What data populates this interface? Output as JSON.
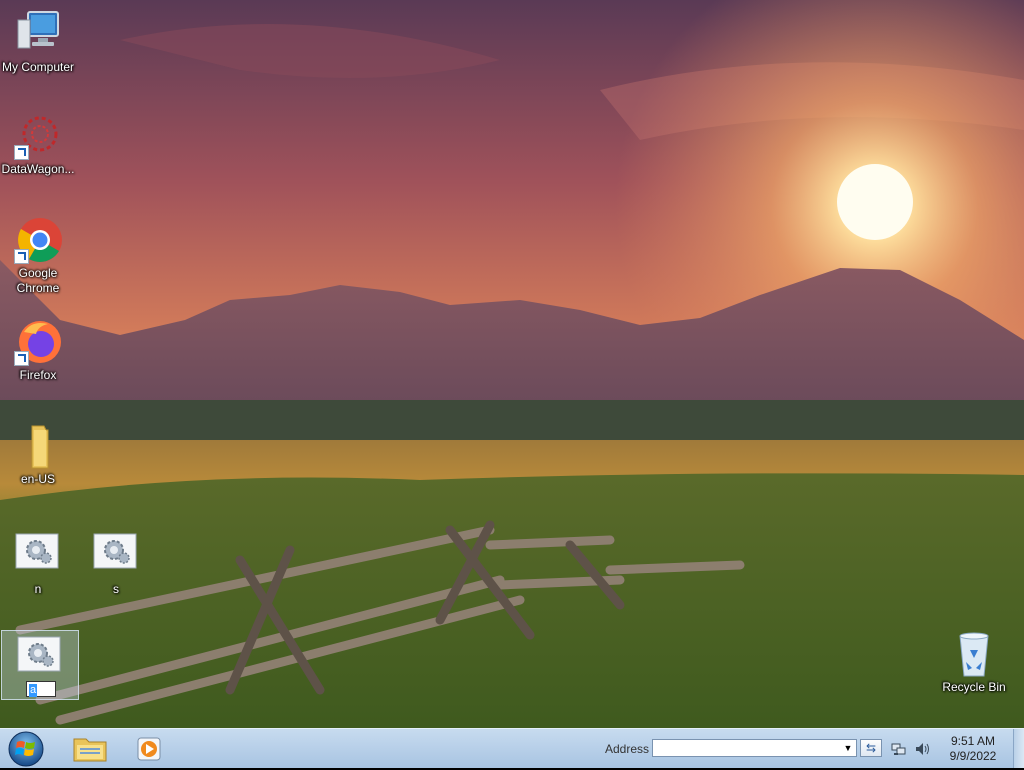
{
  "desktop": {
    "icons": [
      {
        "label": "My Computer"
      },
      {
        "label": "DataWagon..."
      },
      {
        "label": "Google Chrome"
      },
      {
        "label": "Firefox"
      },
      {
        "label": "en-US"
      },
      {
        "label": "n"
      },
      {
        "label": "s"
      },
      {
        "label": "a"
      },
      {
        "label": "Recycle Bin"
      }
    ]
  },
  "taskbar": {
    "address_label": "Address",
    "address_value": "",
    "time": "9:51 AM",
    "date": "9/9/2022"
  },
  "icons": {
    "start": "windows-orb-icon",
    "explorer": "folder-icon",
    "media": "media-player-icon",
    "network": "network-icon",
    "volume": "speaker-icon"
  }
}
